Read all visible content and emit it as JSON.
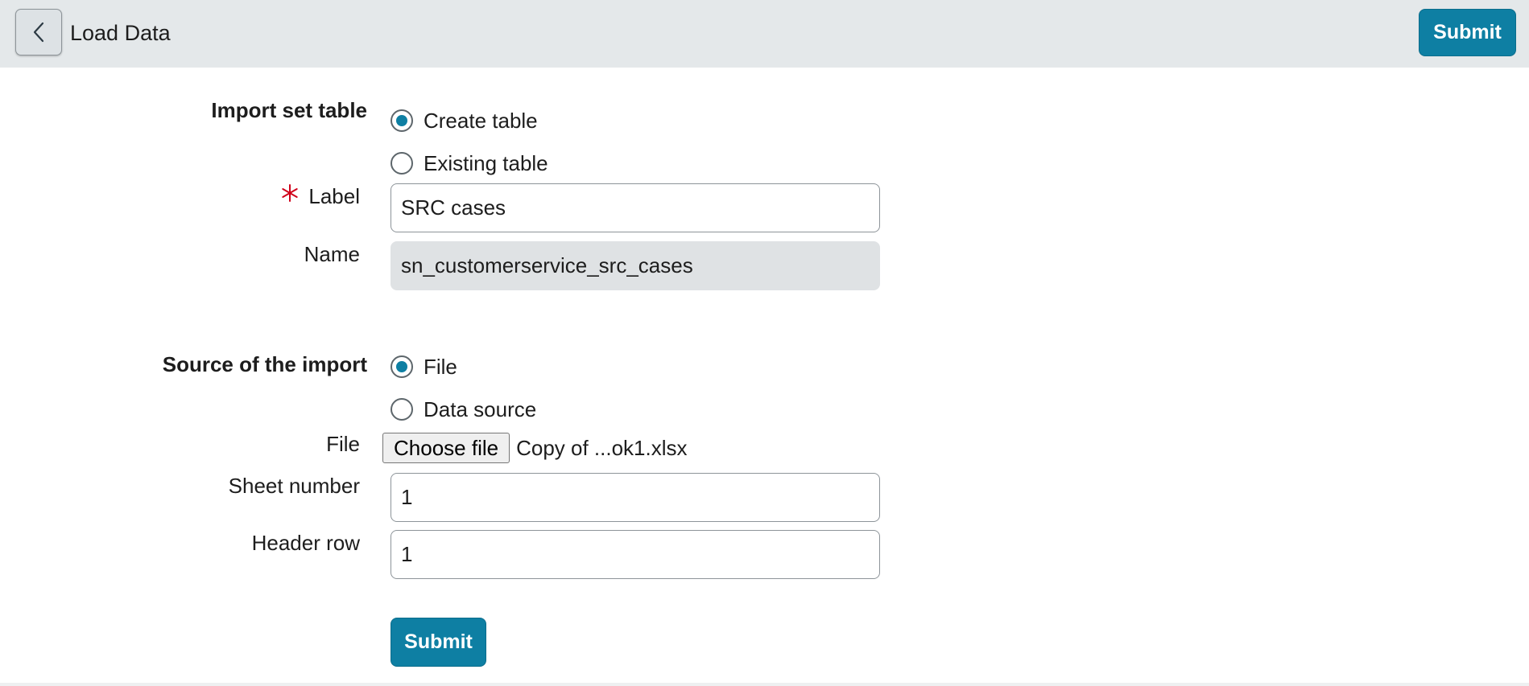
{
  "header": {
    "title": "Load Data",
    "back_icon": "chevron-left-icon",
    "submit_label": "Submit"
  },
  "import_set_table": {
    "section_label": "Import set table",
    "options": [
      {
        "label": "Create table",
        "selected": true
      },
      {
        "label": "Existing table",
        "selected": false
      }
    ]
  },
  "label_field": {
    "label": "Label",
    "required": true,
    "value": "SRC cases"
  },
  "name_field": {
    "label": "Name",
    "value": "sn_customerservice_src_cases"
  },
  "source": {
    "section_label": "Source of the import",
    "options": [
      {
        "label": "File",
        "selected": true
      },
      {
        "label": "Data source",
        "selected": false
      }
    ]
  },
  "file_field": {
    "label": "File",
    "button_label": "Choose file",
    "file_name": "Copy of ...ok1.xlsx"
  },
  "sheet_number": {
    "label": "Sheet number",
    "value": "1"
  },
  "header_row": {
    "label": "Header row",
    "value": "1"
  },
  "footer": {
    "submit_label": "Submit"
  },
  "colors": {
    "accent": "#0e7fa3",
    "header_bg": "#e4e8ea",
    "required": "#d0021b",
    "readonly_bg": "#dfe2e4"
  }
}
